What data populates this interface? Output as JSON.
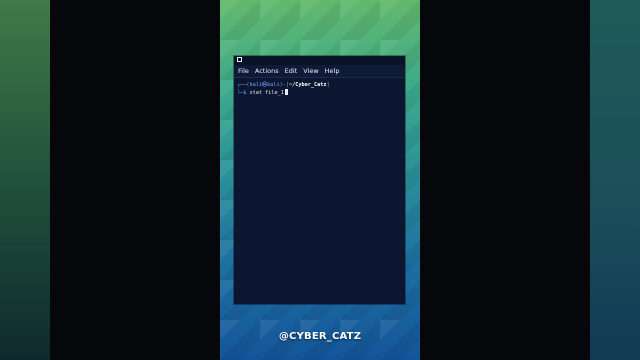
{
  "terminal": {
    "menu": [
      "File",
      "Actions",
      "Edit",
      "View",
      "Help"
    ],
    "prompt_user": "(kali㉿kali)",
    "prompt_path": "~/Cyber_Catz",
    "prompt_symbol": "$",
    "command": "stat file_1"
  },
  "watermark": "@CYBER_CATZ",
  "colors": {
    "terminal_bg": "#0d1630",
    "prompt_accent": "#6ea8ff"
  },
  "icons": {
    "window": "terminal-window-icon"
  }
}
